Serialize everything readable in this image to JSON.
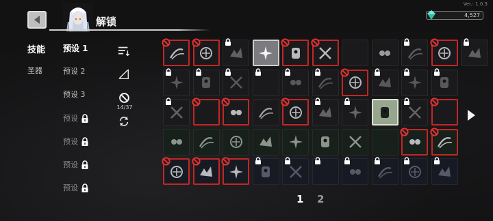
{
  "version": "Ver.: 1.0.3",
  "header": {
    "title": "解锁"
  },
  "currency": {
    "amount": "4,527",
    "icon": "gem-icon"
  },
  "categories": [
    {
      "label": "技能",
      "active": true
    },
    {
      "label": "圣器",
      "active": false
    }
  ],
  "presets": [
    {
      "label": "预设 1",
      "active": true,
      "locked": false
    },
    {
      "label": "预设 2",
      "active": false,
      "locked": false
    },
    {
      "label": "预设 3",
      "active": false,
      "locked": false
    },
    {
      "label": "预设",
      "active": false,
      "locked": true
    },
    {
      "label": "预设",
      "active": false,
      "locked": true
    },
    {
      "label": "预设",
      "active": false,
      "locked": true
    },
    {
      "label": "预设",
      "active": false,
      "locked": true
    }
  ],
  "tools": {
    "sort_icon": "sort-icon",
    "filter_icon": "slope-icon",
    "ban_icon": "ban-icon",
    "ban_count": "14/37",
    "refresh_icon": "refresh-icon"
  },
  "pagination": {
    "pages": [
      "1",
      "2"
    ],
    "current": "1"
  },
  "colors": {
    "ban": "#c42626",
    "selected": "#98a690",
    "accent": "#2fbfa8"
  },
  "skills": [
    [
      {
        "icon": "slash-icon",
        "banned": true,
        "locked": false
      },
      {
        "icon": "claw-icon",
        "banned": true,
        "locked": false
      },
      {
        "icon": "wind-icon",
        "banned": false,
        "locked": true
      },
      {
        "icon": "burst-icon",
        "banned": false,
        "locked": false,
        "highlight": true
      },
      {
        "icon": "brute-icon",
        "banned": true,
        "locked": false
      },
      {
        "icon": "warrior-icon",
        "banned": true,
        "locked": false
      },
      {
        "icon": "flask-icon",
        "banned": false,
        "locked": false
      },
      {
        "icon": "potion-icon",
        "banned": false,
        "locked": false
      },
      {
        "icon": "orb-icon",
        "banned": false,
        "locked": true
      },
      {
        "icon": "spears-icon",
        "banned": true,
        "locked": false
      },
      {
        "icon": "beast-icon",
        "banned": false,
        "locked": true
      }
    ],
    [
      {
        "icon": "feather-icon",
        "banned": false,
        "locked": true
      },
      {
        "icon": "blades-icon",
        "banned": false,
        "locked": true
      },
      {
        "icon": "leaf-icon",
        "banned": false,
        "locked": true
      },
      {
        "icon": "target-icon",
        "banned": false,
        "locked": true
      },
      {
        "icon": "swords-icon",
        "banned": false,
        "locked": true
      },
      {
        "icon": "vortex-icon",
        "banned": false,
        "locked": true
      },
      {
        "icon": "eye-icon",
        "banned": true,
        "locked": false
      },
      {
        "icon": "dagger-icon",
        "banned": false,
        "locked": true
      },
      {
        "icon": "vine-icon",
        "banned": false,
        "locked": true
      },
      {
        "icon": "glove-icon",
        "banned": false,
        "locked": true
      }
    ],
    [
      {
        "icon": "spark-icon",
        "banned": false,
        "locked": true
      },
      {
        "icon": "shard-icon",
        "banned": true,
        "locked": false
      },
      {
        "icon": "chain-icon",
        "banned": true,
        "locked": false
      },
      {
        "icon": "bolt-icon",
        "banned": false,
        "locked": false
      },
      {
        "icon": "mushroom-icon",
        "banned": true,
        "locked": false
      },
      {
        "icon": "flame-icon",
        "banned": false,
        "locked": true
      },
      {
        "icon": "skull-icon",
        "banned": false,
        "locked": true
      },
      {
        "icon": "biohazard-icon",
        "banned": false,
        "locked": false,
        "selected": true
      },
      {
        "icon": "sword-icon",
        "banned": false,
        "locked": true
      },
      {
        "icon": "bomb-icon",
        "banned": true,
        "locked": false
      }
    ],
    [
      {
        "icon": "hook-icon",
        "banned": false,
        "locked": false
      },
      {
        "icon": "cross-icon",
        "banned": false,
        "locked": false
      },
      {
        "icon": "wings-icon",
        "banned": false,
        "locked": false
      },
      {
        "icon": "star-icon",
        "banned": false,
        "locked": false
      },
      {
        "icon": "scatter-icon",
        "banned": false,
        "locked": false
      },
      {
        "icon": "dash-icon",
        "banned": false,
        "locked": false
      },
      {
        "icon": "shuriken-icon",
        "banned": false,
        "locked": false
      },
      {
        "icon": "shield-icon",
        "banned": false,
        "locked": false
      },
      {
        "icon": "mask-icon",
        "banned": true,
        "locked": false
      },
      {
        "icon": "ghost-icon",
        "banned": true,
        "locked": false
      }
    ],
    [
      {
        "icon": "scroll-icon",
        "banned": true,
        "locked": false
      },
      {
        "icon": "hammer-icon",
        "banned": true,
        "locked": false
      },
      {
        "icon": "lightning-icon",
        "banned": true,
        "locked": false
      },
      {
        "icon": "strike-icon",
        "banned": false,
        "locked": true
      },
      {
        "icon": "snail-icon",
        "banned": false,
        "locked": true
      },
      {
        "icon": "wand-icon",
        "banned": false,
        "locked": true
      },
      {
        "icon": "spiral-icon",
        "banned": false,
        "locked": true
      },
      {
        "icon": "wave-icon",
        "banned": false,
        "locked": true
      },
      {
        "icon": "rune-icon",
        "banned": false,
        "locked": true
      },
      {
        "icon": "serpent-icon",
        "banned": false,
        "locked": true
      }
    ]
  ]
}
